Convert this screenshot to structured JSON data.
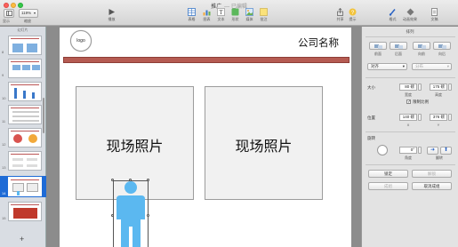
{
  "window": {
    "title": "推广",
    "edited": "— 已编辑"
  },
  "toolbar": {
    "view_label": "显示",
    "zoom_value": "119%",
    "zoom_label": "缩放",
    "play_label": "播放",
    "items": [
      {
        "label": "表格",
        "icon": "table-icon"
      },
      {
        "label": "图表",
        "icon": "chart-icon"
      },
      {
        "label": "文本",
        "icon": "text-icon"
      },
      {
        "label": "形状",
        "icon": "shape-icon"
      },
      {
        "label": "媒体",
        "icon": "media-icon"
      },
      {
        "label": "批注",
        "icon": "comment-icon"
      }
    ],
    "share_label": "共享",
    "tips_label": "提示",
    "format_label": "格式",
    "animate_label": "动画效果",
    "document_label": "文稿"
  },
  "sidebar": {
    "header": "幻灯片",
    "slides": [
      {
        "num": "8"
      },
      {
        "num": "9"
      },
      {
        "num": "10"
      },
      {
        "num": "11"
      },
      {
        "num": "12"
      },
      {
        "num": "13"
      },
      {
        "num": "14"
      },
      {
        "num": "15"
      }
    ],
    "selected": "14",
    "add_label": "+"
  },
  "slide": {
    "logo": "logo",
    "company_name": "公司名称",
    "photo_left": "现场照片",
    "photo_right": "现场照片",
    "colors": {
      "bar": "#b55b52",
      "person": "#5bb8f0"
    }
  },
  "inspector": {
    "title": "排列",
    "front_label": "前面",
    "back_label": "后面",
    "forward_label": "向前",
    "backward_label": "向后",
    "align_value": "对齐",
    "distribute_value": "分布",
    "size_label": "大小",
    "width_value": "80 磅",
    "height_value": "175 磅",
    "width_label": "宽度",
    "height_label": "高度",
    "constrain_label": "限制比例",
    "constrain_checked": true,
    "position_label": "位置",
    "x_value": "140 磅",
    "y_value": "376 磅",
    "x_label": "X",
    "y_label": "Y",
    "rotate_label": "旋转",
    "angle_value": "0°",
    "angle_label": "角度",
    "flip_label": "翻转",
    "lock_label": "锁定",
    "unlock_label": "解锁",
    "group_label": "成组",
    "ungroup_label": "取消成组"
  }
}
